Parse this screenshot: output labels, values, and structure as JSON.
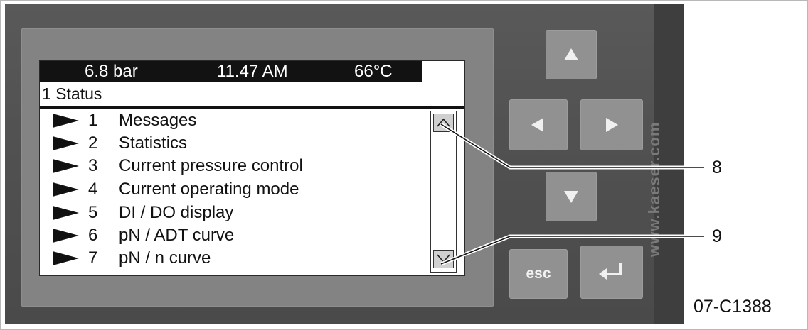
{
  "status_bar": {
    "pressure": "6.8 bar",
    "time": "11.47 AM",
    "temperature": "66°C"
  },
  "screen": {
    "title": "1 Status",
    "menu_items": [
      {
        "number": "1",
        "label": "Messages"
      },
      {
        "number": "2",
        "label": "Statistics"
      },
      {
        "number": "3",
        "label": "Current pressure control"
      },
      {
        "number": "4",
        "label": "Current operating mode"
      },
      {
        "number": "5",
        "label": "DI / DO display"
      },
      {
        "number": "6",
        "label": "pN / ADT curve"
      },
      {
        "number": "7",
        "label": "pN / n curve"
      }
    ]
  },
  "keypad": {
    "esc_label": "esc",
    "icons": [
      "up-arrow-icon",
      "left-arrow-icon",
      "right-arrow-icon",
      "down-arrow-icon",
      "enter-return-icon"
    ]
  },
  "callouts": {
    "scroll_up": "8",
    "scroll_down": "9"
  },
  "watermark": "www.kaeser.com",
  "figure_id": "07-C1388",
  "colors": {
    "panel": "#555555",
    "bezel": "#838383",
    "button": "#919191",
    "lcd_background": "#ffffff",
    "status_bar": "#121212"
  }
}
